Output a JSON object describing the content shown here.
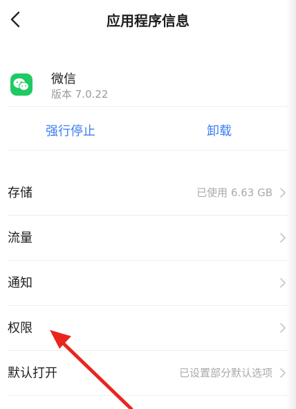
{
  "header": {
    "title": "应用程序信息",
    "back_icon": "chevron-left-icon"
  },
  "app": {
    "name": "微信",
    "version": "版本 7.0.22",
    "icon": "wechat-icon",
    "icon_color": "#1fc964"
  },
  "actions": {
    "force_stop": "强行停止",
    "uninstall": "卸载",
    "accent": "#3c7df2"
  },
  "settings": [
    {
      "label": "存储",
      "value": "已使用 6.63 GB"
    },
    {
      "label": "流量",
      "value": ""
    },
    {
      "label": "通知",
      "value": ""
    },
    {
      "label": "权限",
      "value": ""
    },
    {
      "label": "默认打开",
      "value": "已设置部分默认选项"
    }
  ],
  "annotation": {
    "color": "#e8261e",
    "icon": "red-arrow-annotation"
  }
}
